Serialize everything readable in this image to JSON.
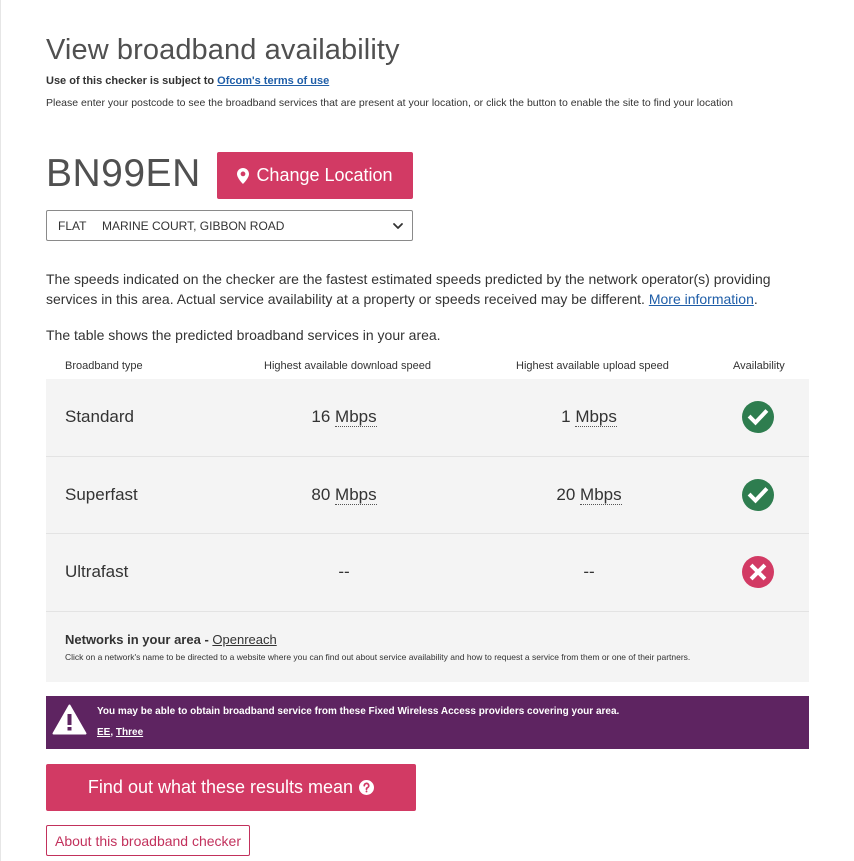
{
  "page": {
    "title": "View broadband availability",
    "terms_prefix": "Use of this checker is subject to ",
    "terms_link": "Ofcom's terms of use",
    "intro": "Please enter your postcode to see the broadband services that are present at your location, or click the button to enable the site to find your location"
  },
  "location": {
    "postcode": "BN99EN",
    "change_button": "Change Location",
    "address_flat": "FLAT",
    "address_street": "MARINE COURT, GIBBON ROAD"
  },
  "notes": {
    "speeds_text": "The speeds indicated on the checker are the fastest estimated speeds predicted by the network operator(s) providing services in this area. Actual service availability at a property or speeds received may be different. ",
    "more_info_link": "More information",
    "table_intro": "The table shows the predicted broadband services in your area."
  },
  "table": {
    "headers": {
      "type": "Broadband type",
      "download": "Highest available download speed",
      "upload": "Highest available upload speed",
      "availability": "Availability"
    },
    "rows": [
      {
        "type": "Standard",
        "download_value": "16",
        "download_unit": "Mbps",
        "upload_value": "1",
        "upload_unit": "Mbps",
        "available": true
      },
      {
        "type": "Superfast",
        "download_value": "80",
        "download_unit": "Mbps",
        "upload_value": "20",
        "upload_unit": "Mbps",
        "available": true
      },
      {
        "type": "Ultrafast",
        "download_value": "--",
        "download_unit": "",
        "upload_value": "--",
        "upload_unit": "",
        "available": false
      }
    ]
  },
  "networks": {
    "title": "Networks in your area - ",
    "provider": "Openreach",
    "hint": "Click on a network's name to be directed to a website where you can find out about service availability and how to request a service from them or one of their partners."
  },
  "fwa": {
    "message": "You may be able to obtain broadband service from these Fixed Wireless Access providers covering your area.",
    "provider_1": "EE",
    "separator": ", ",
    "provider_2": "Three"
  },
  "buttons": {
    "results": "Find out what these results mean",
    "about": "About this broadband checker"
  },
  "colors": {
    "accent": "#d23a64",
    "available": "#2e7d4f",
    "unavailable": "#d23a64",
    "fwa_banner": "#5e2461"
  }
}
